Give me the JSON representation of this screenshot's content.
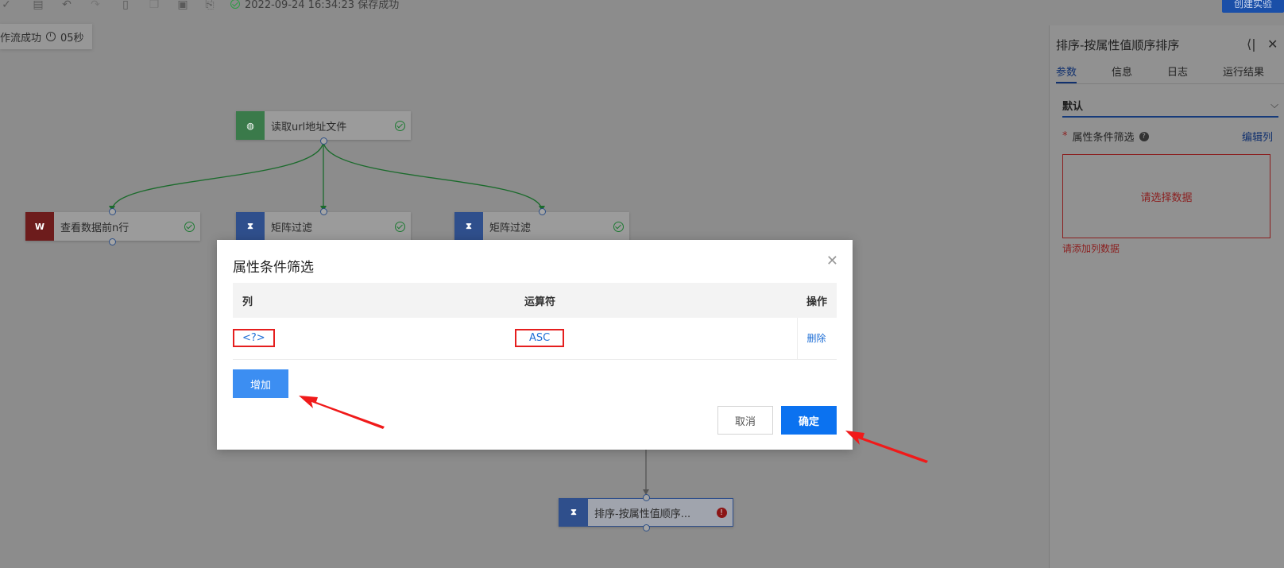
{
  "toolbar": {
    "save_status": "2022-09-24 16:34:23 保存成功",
    "create_button": "创建实验"
  },
  "run_badge": {
    "text": "作流成功",
    "duration": "05秒"
  },
  "nodes": {
    "read_url": "读取url地址文件",
    "view_top_n": "查看数据前n行",
    "matrix_filter_1": "矩阵过滤",
    "matrix_filter_2": "矩阵过滤",
    "sort": "排序-按属性值顺序..."
  },
  "panel": {
    "title": "排序-按属性值顺序排序",
    "tabs": [
      "参数",
      "信息",
      "日志",
      "运行结果"
    ],
    "section": "默认",
    "field_required_mark": "*",
    "field_label": "属性条件筛选",
    "edit_columns": "编辑列",
    "empty_placeholder": "请选择数据",
    "error_text": "请添加列数据"
  },
  "modal": {
    "title": "属性条件筛选",
    "columns": [
      "列",
      "运算符",
      "操作"
    ],
    "rows": [
      {
        "column": "<?>",
        "operator": "ASC",
        "action": "删除"
      }
    ],
    "add_button": "增加",
    "cancel_button": "取消",
    "ok_button": "确定"
  },
  "colors": {
    "primary": "#0b72f0",
    "highlight_box": "#e51e1e",
    "success": "#2e9c46"
  }
}
